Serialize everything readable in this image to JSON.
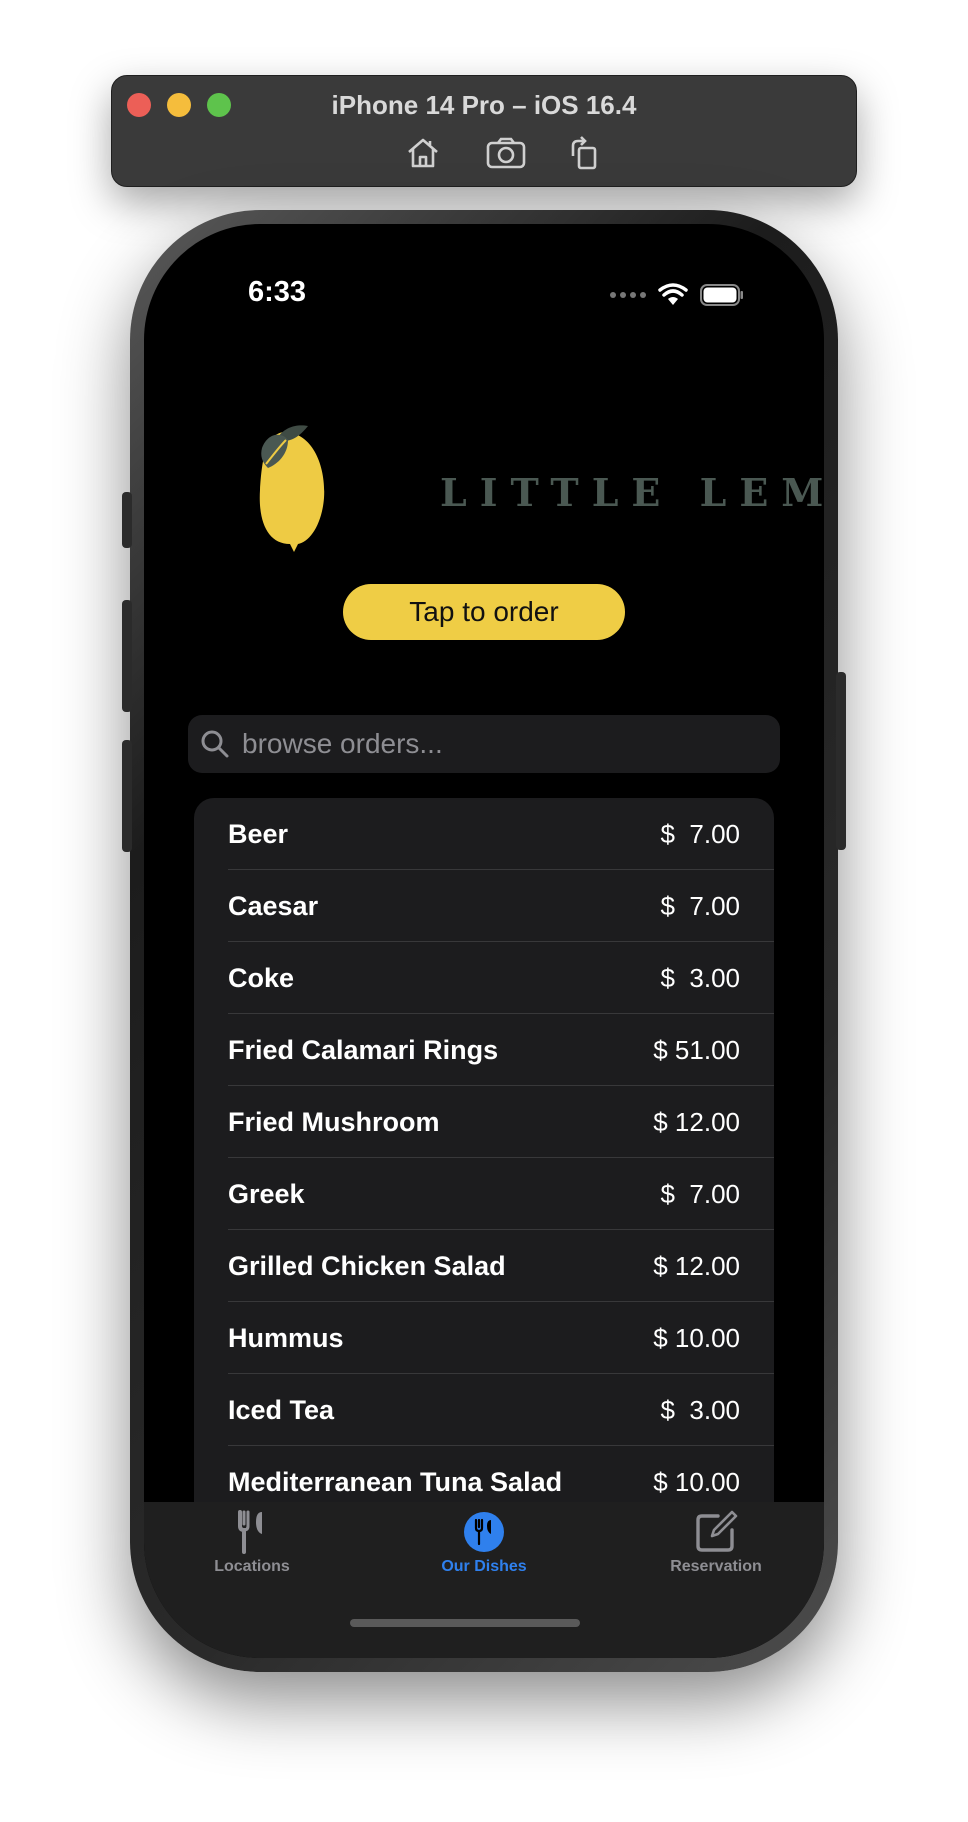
{
  "simulator": {
    "title": "iPhone 14 Pro – iOS 16.4",
    "toolbar_icons": [
      "home-icon",
      "screenshot-icon",
      "rotate-icon"
    ]
  },
  "status_bar": {
    "time": "6:33"
  },
  "logo": {
    "text": "LITTLE LEMON"
  },
  "order_button": {
    "label": "Tap to order"
  },
  "search": {
    "placeholder": "browse orders..."
  },
  "menu_items": [
    {
      "name": "Beer",
      "price": "$  7.00"
    },
    {
      "name": "Caesar",
      "price": "$  7.00"
    },
    {
      "name": "Coke",
      "price": "$  3.00"
    },
    {
      "name": "Fried Calamari Rings",
      "price": "$ 51.00"
    },
    {
      "name": "Fried Mushroom",
      "price": "$ 12.00"
    },
    {
      "name": "Greek",
      "price": "$  7.00"
    },
    {
      "name": "Grilled Chicken Salad",
      "price": "$ 12.00"
    },
    {
      "name": "Hummus",
      "price": "$ 10.00"
    },
    {
      "name": "Iced Tea",
      "price": "$  3.00"
    },
    {
      "name": "Mediterranean Tuna Salad",
      "price": "$ 10.00"
    }
  ],
  "tab_bar": {
    "tabs": [
      {
        "label": "Locations",
        "icon": "fork-knife-icon",
        "active": false
      },
      {
        "label": "Our Dishes",
        "icon": "fork-knife-circle-icon",
        "active": true
      },
      {
        "label": "Reservation",
        "icon": "compose-icon",
        "active": false
      }
    ]
  },
  "colors": {
    "accent": "#2f80ed",
    "button_yellow": "#efcd45",
    "logo_text": "#4a5852"
  }
}
